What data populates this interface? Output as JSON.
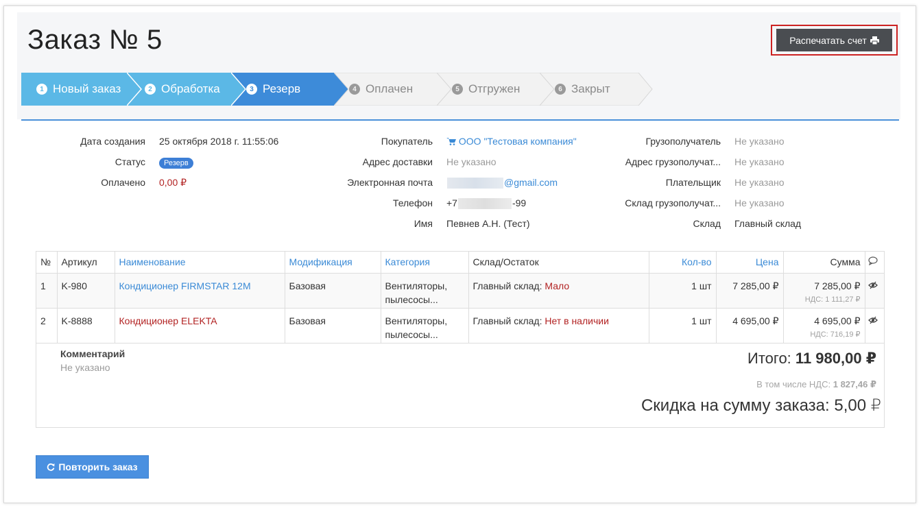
{
  "page": {
    "title": "Заказ № 5"
  },
  "toolbar": {
    "print_label": "Распечатать счет"
  },
  "steps": [
    {
      "num": "1",
      "label": "Новый заказ",
      "state": "done"
    },
    {
      "num": "2",
      "label": "Обработка",
      "state": "done"
    },
    {
      "num": "3",
      "label": "Резерв",
      "state": "active"
    },
    {
      "num": "4",
      "label": "Оплачен",
      "state": "todo"
    },
    {
      "num": "5",
      "label": "Отгружен",
      "state": "todo"
    },
    {
      "num": "6",
      "label": "Закрыт",
      "state": "todo"
    }
  ],
  "info": {
    "created_label": "Дата создания",
    "created_value": "25 октября 2018 г. 11:55:06",
    "status_label": "Статус",
    "status_value": "Резерв",
    "paid_label": "Оплачено",
    "paid_value": "0,00 ₽",
    "buyer_label": "Покупатель",
    "buyer_value": "ООО \"Тестовая компания\"",
    "address_label": "Адрес доставки",
    "address_value": "Не указано",
    "email_label": "Электронная почта",
    "email_value": "@gmail.com",
    "phone_label": "Телефон",
    "phone_prefix": "+7",
    "phone_suffix": "-99",
    "name_label": "Имя",
    "name_value": "Певнев А.Н. (Тест)",
    "consignee_label": "Грузополучатель",
    "consignee_value": "Не указано",
    "consignee_addr_label": "Адрес грузополучат...",
    "consignee_addr_value": "Не указано",
    "payer_label": "Плательщик",
    "payer_value": "Не указано",
    "consignee_wh_label": "Склад грузополучат...",
    "consignee_wh_value": "Не указано",
    "warehouse_label": "Склад",
    "warehouse_value": "Главный склад"
  },
  "table": {
    "headers": {
      "num": "№",
      "sku": "Артикул",
      "name": "Наименование",
      "mod": "Модификация",
      "cat": "Категория",
      "stock": "Склад/Остаток",
      "qty": "Кол-во",
      "price": "Цена",
      "sum": "Сумма"
    },
    "rows": [
      {
        "num": "1",
        "sku": "K-980",
        "name": "Кондиционер FIRMSTAR 12M",
        "mod": "Базовая",
        "cat1": "Вентиляторы,",
        "cat2": "пылесосы...",
        "stock_wh": "Главный склад:",
        "stock_status": "Мало",
        "qty": "1 шт",
        "price": "7 285,00 ₽",
        "sum": "7 285,00 ₽",
        "vat": "НДС: 1 111,27 ₽"
      },
      {
        "num": "2",
        "sku": "K-8888",
        "name": "Кондиционер ELEKTA",
        "mod": "Базовая",
        "cat1": "Вентиляторы,",
        "cat2": "пылесосы...",
        "stock_wh": "Главный склад:",
        "stock_status": "Нет в наличии",
        "qty": "1 шт",
        "price": "4 695,00 ₽",
        "sum": "4 695,00 ₽",
        "vat": "НДС: 716,19 ₽"
      }
    ]
  },
  "summary": {
    "comment_label": "Комментарий",
    "comment_value": "Не указано",
    "total_label": "Итого:",
    "total_value": "11 980,00 ₽",
    "vat_label": "В том числе НДС:",
    "vat_value": "1 827,46 ₽",
    "discount_label": "Скидка на сумму заказа:",
    "discount_value": "5,00 ₽"
  },
  "actions": {
    "repeat_label": "Повторить заказ"
  },
  "colors": {
    "accent": "#4a90d9",
    "done_step": "#5bb8e6",
    "active_step": "#3d8bd9",
    "print_button": "#4a4d51",
    "alert_red": "#b22222"
  }
}
